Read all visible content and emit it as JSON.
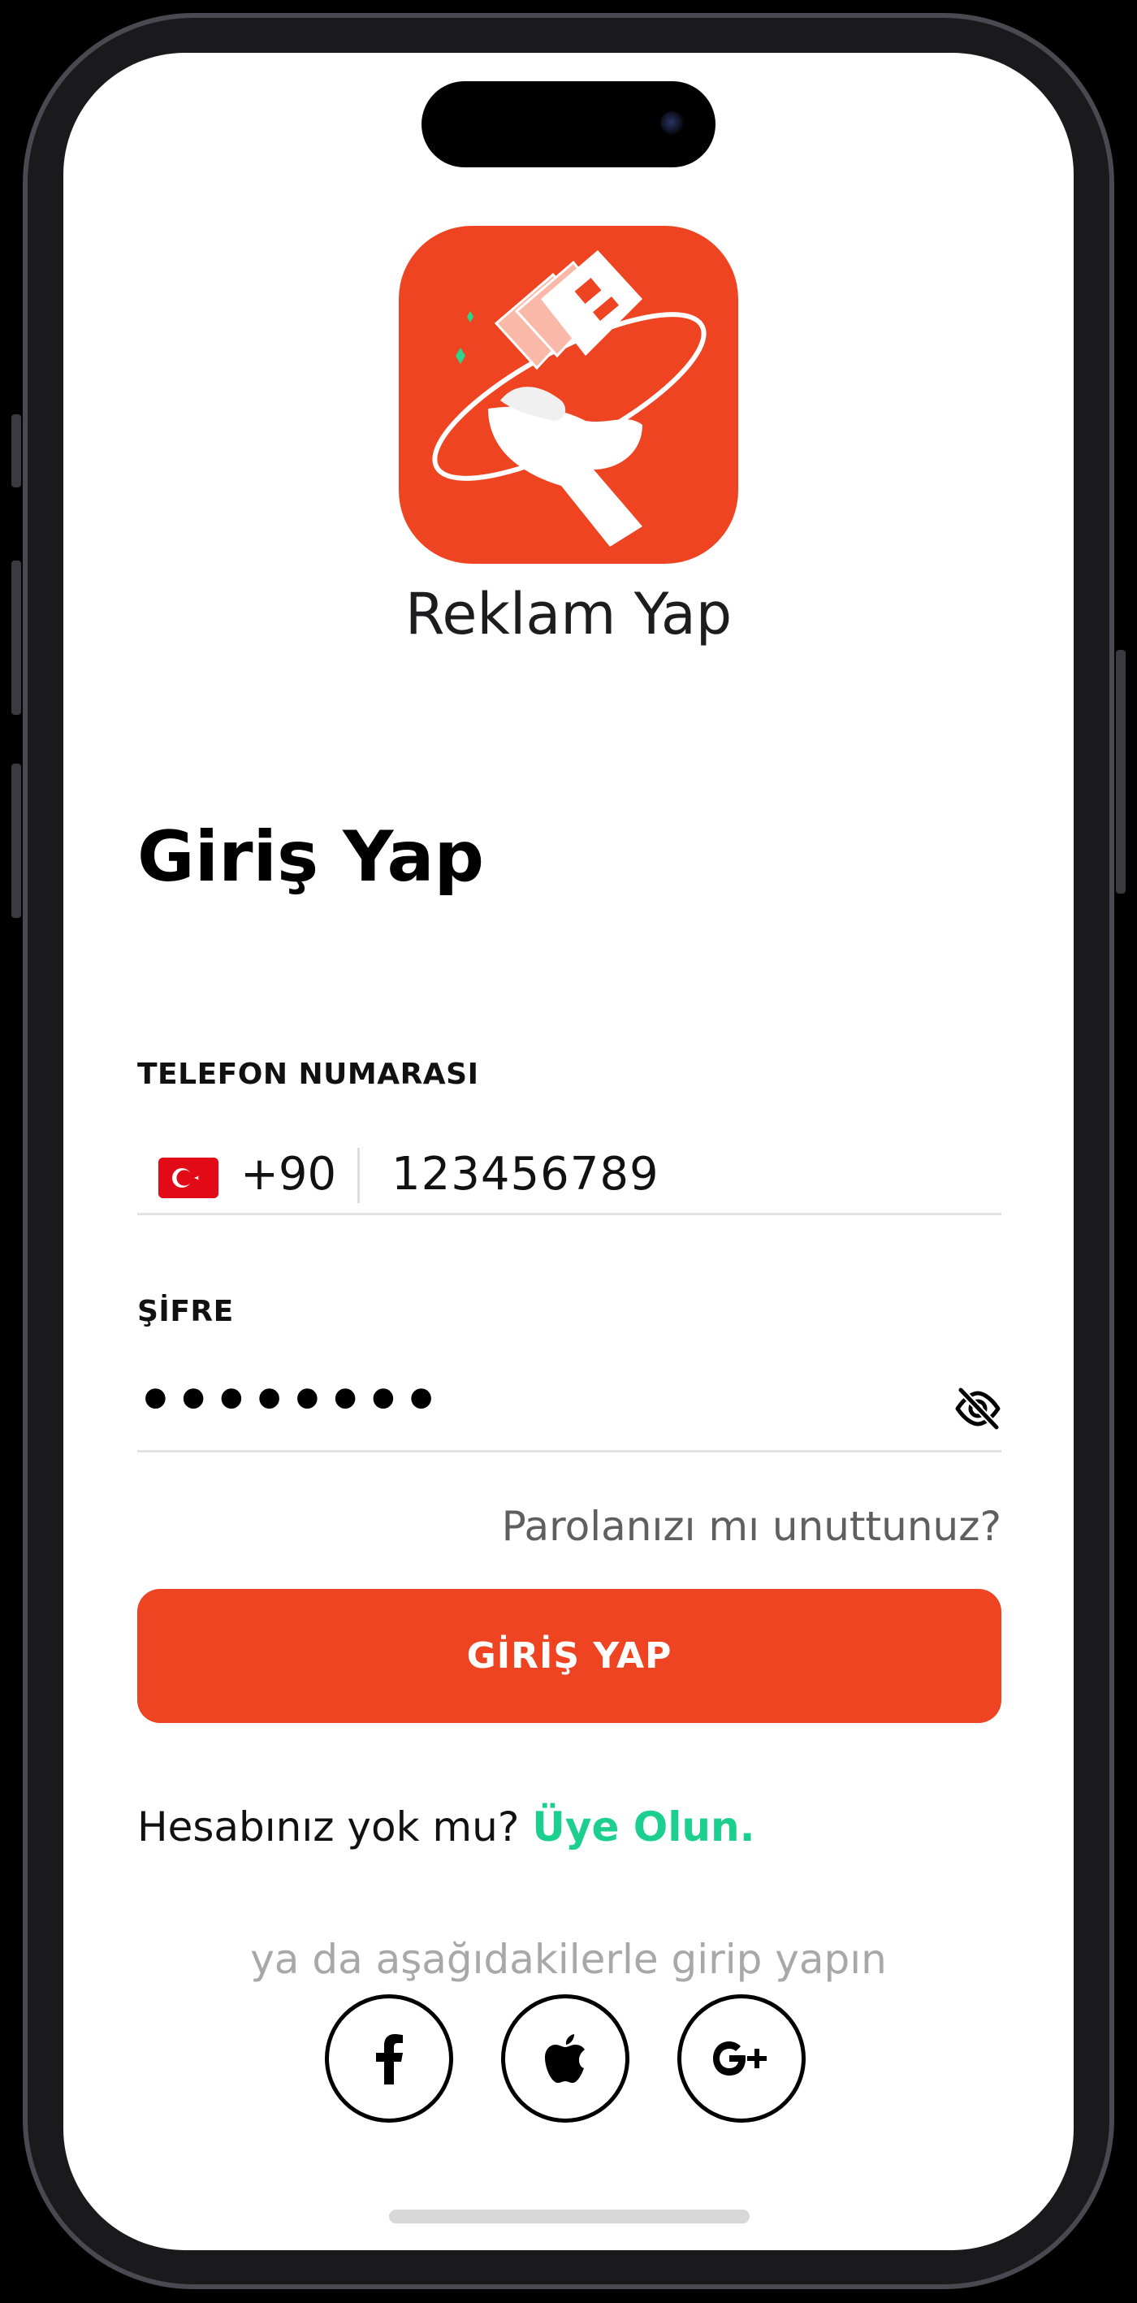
{
  "app": {
    "name": "Reklam Yap"
  },
  "login": {
    "title": "Giriş Yap",
    "phone_label": "TELEFON NUMARASI",
    "country_code": "+90",
    "phone_value": "123456789",
    "password_label": "ŞİFRE",
    "password_masked": "••••••••",
    "forgot_text": "Parolanızı mı unuttunuz?",
    "submit_label": "GİRİŞ YAP",
    "no_account_text": "Hesabınız yok mu?",
    "signup_link": "Üye Olun.",
    "social_divider_text": "ya da aşağıdakilerle girip yapın"
  },
  "icons": {
    "flag": "turkey-flag-icon",
    "password_toggle": "eye-off-icon",
    "social": [
      "facebook-icon",
      "apple-icon",
      "google-plus-icon"
    ]
  },
  "colors": {
    "brand": "#ee4422",
    "link": "#1ccf8f",
    "muted": "#a8a8a8"
  }
}
